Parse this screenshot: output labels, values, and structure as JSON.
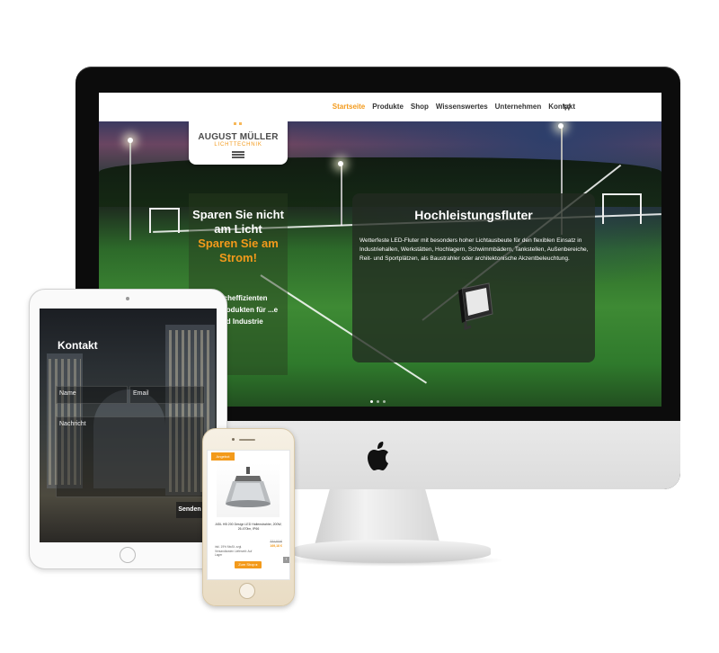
{
  "site": {
    "brand": {
      "name": "AUGUST MÜLLER",
      "sub": "LICHTTECHNIK"
    },
    "nav": [
      {
        "label": "Startseite",
        "active": true
      },
      {
        "label": "Produkte",
        "active": false
      },
      {
        "label": "Shop",
        "active": false
      },
      {
        "label": "Wissenswertes",
        "active": false
      },
      {
        "label": "Unternehmen",
        "active": false
      },
      {
        "label": "Kontakt",
        "active": false
      }
    ],
    "cart_icon": "cart-icon",
    "slide_left": {
      "headline": "Sparen Sie nicht am Licht",
      "headline_accent": "Sparen Sie am Strom!",
      "body": "...cheffizienten ...rodukten für ...e und Industrie"
    },
    "slide_card": {
      "title": "Hochleistungsfluter",
      "text": "Wetterfeste LED-Fluter mit besonders hoher Lichtausbeute für den flexiblen Einsatz in Industriehallen, Werkstätten, Hochlagern, Schwimmbädern, Tankstellen, Außenbereiche, Reit- und Sportplätzen, als Baustrahler oder architektonische Akzentbeleuchtung."
    },
    "slider_dots": 3,
    "accent_color": "#f39a1b"
  },
  "ipad": {
    "title": "Kontakt",
    "fields": {
      "name": "Name",
      "email": "Email",
      "message": "Nachricht"
    },
    "send": "Senden"
  },
  "iphone": {
    "badge": "Angebot",
    "product_name": "ASIL HB 200 Design LED Hallenstrahler, 200W, 26.470lm, IP66",
    "price_old": "331,53 €",
    "price_new": "169,18 €",
    "info": "inkl. 19% MwSt. zzgl. Versandkosten Lieferzeit: Auf Lager",
    "shop_button": "Zum Shop ▸"
  }
}
